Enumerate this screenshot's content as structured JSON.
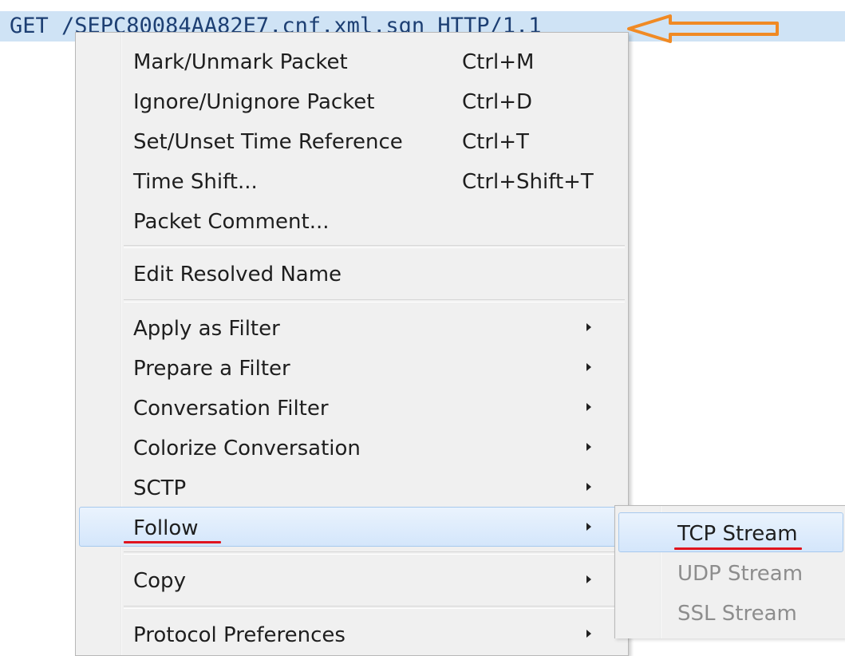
{
  "packet": {
    "text": "GET /SEPC80084AA82E7.cnf.xml.sgn HTTP/1.1"
  },
  "annotation_color": "#f08a24",
  "underline_color": "#e0141e",
  "menu": {
    "items": [
      {
        "label": "Mark/Unmark Packet",
        "shortcut": "Ctrl+M"
      },
      {
        "label": "Ignore/Unignore Packet",
        "shortcut": "Ctrl+D"
      },
      {
        "label": "Set/Unset Time Reference",
        "shortcut": "Ctrl+T"
      },
      {
        "label": "Time Shift...",
        "shortcut": "Ctrl+Shift+T"
      },
      {
        "label": "Packet Comment..."
      },
      {
        "label": "Edit Resolved Name"
      },
      {
        "label": "Apply as Filter"
      },
      {
        "label": "Prepare a Filter"
      },
      {
        "label": "Conversation Filter"
      },
      {
        "label": "Colorize Conversation"
      },
      {
        "label": "SCTP"
      },
      {
        "label": "Follow"
      },
      {
        "label": "Copy"
      },
      {
        "label": "Protocol Preferences"
      }
    ]
  },
  "submenu": {
    "items": [
      {
        "label": "TCP Stream"
      },
      {
        "label": "UDP Stream"
      },
      {
        "label": "SSL Stream"
      }
    ]
  }
}
